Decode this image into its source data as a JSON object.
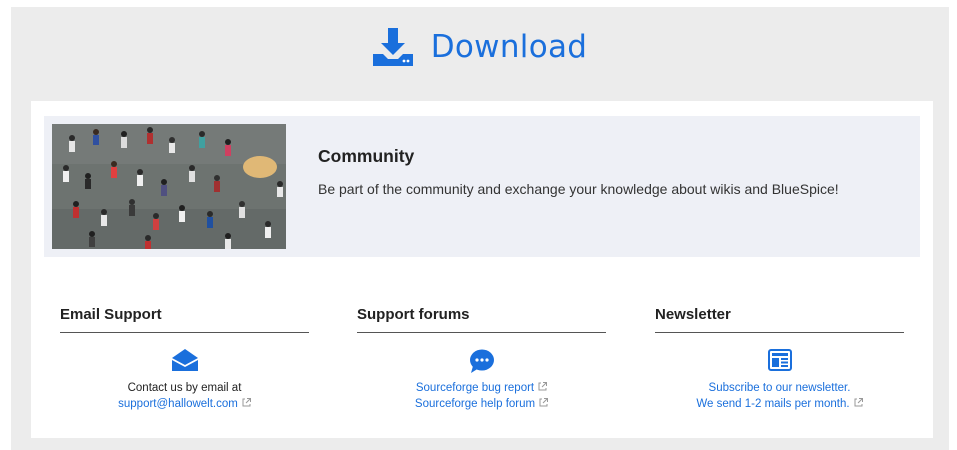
{
  "header": {
    "title": "Download",
    "icon": "download-icon",
    "accent": "#1a6fdc"
  },
  "community": {
    "title": "Community",
    "description": "Be part of the community and exchange your knowledge about wikis and BlueSpice!",
    "image": "crowd-photo"
  },
  "columns": [
    {
      "heading": "Email Support",
      "icon": "envelope-icon",
      "line1": "Contact us by email at",
      "link": "support@hallowelt.com"
    },
    {
      "heading": "Support forums",
      "icon": "chat-bubble-icon",
      "link1": "Sourceforge bug report",
      "link2": "Sourceforge help forum"
    },
    {
      "heading": "Newsletter",
      "icon": "newspaper-icon",
      "link1": "Subscribe to our newsletter.",
      "link2": "We send 1-2 mails per month."
    }
  ]
}
